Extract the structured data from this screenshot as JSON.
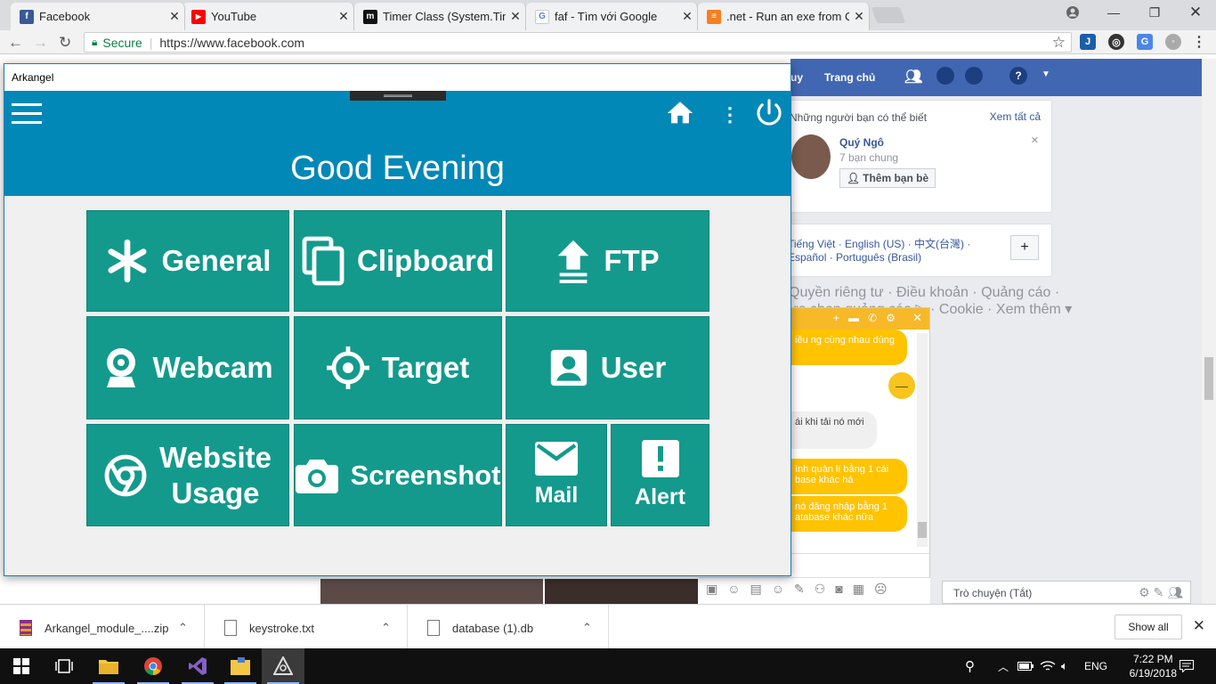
{
  "browser": {
    "tabs": [
      {
        "title": "Facebook",
        "favicon_color": "#3b5998",
        "favicon_glyph": "f"
      },
      {
        "title": "YouTube",
        "favicon_color": "#ff0000",
        "favicon_glyph": "▶"
      },
      {
        "title": "Timer Class (System.Time",
        "favicon_color": "#111111",
        "favicon_glyph": "m"
      },
      {
        "title": "faf - Tìm với Google",
        "favicon_color": "#4285f4",
        "favicon_glyph": "G"
      },
      {
        "title": ".net - Run an exe from C#",
        "favicon_color": "#f48024",
        "favicon_glyph": "≡"
      }
    ],
    "secure_label": "Secure",
    "url": "https://www.facebook.com"
  },
  "facebook": {
    "nav_partial": "uy",
    "nav_home": "Trang chủ",
    "people_header": "Những người bạn có thể biết",
    "see_all": "Xem tất cả",
    "suggest_name": "Quý Ngô",
    "suggest_mutual": "7 bạn chung",
    "add_friend": "Thêm bạn bè",
    "lang_line1": "Tiếng Việt · English (US) · 中文(台灣) ·",
    "lang_line2": "Español · Português (Brasil)",
    "lang_add": "+",
    "footer_line1": "Quyền riêng tư · Điều khoản · Quảng cáo ·",
    "footer_line2": "ựa chọn quảng cáo ▷ · Cookie · Xem thêm ▾",
    "chat_msgs": [
      "iều ng cùng nhau dùng",
      "ái khi tải nó mới",
      "ình quản lí bằng 1 cái base khác hả",
      "nó đăng nhập bằng 1 atabase khác nữa"
    ],
    "chat_status": "Trò chuyện (Tắt)"
  },
  "app": {
    "window_title": "Arkangel",
    "greeting": "Good Evening",
    "accent": "#0288b7",
    "tile_color": "#139a8c",
    "tiles": {
      "general": "General",
      "clipboard": "Clipboard",
      "ftp": "FTP",
      "webcam": "Webcam",
      "target": "Target",
      "user": "User",
      "website_line1": "Website",
      "website_line2": "Usage",
      "screenshot": "Screenshot",
      "mail": "Mail",
      "alert": "Alert"
    }
  },
  "downloads": {
    "items": [
      "Arkangel_module_....zip",
      "keystroke.txt",
      "database (1).db"
    ],
    "show_all": "Show all"
  },
  "taskbar": {
    "lang": "ENG",
    "time": "7:22 PM",
    "date": "6/19/2018"
  }
}
